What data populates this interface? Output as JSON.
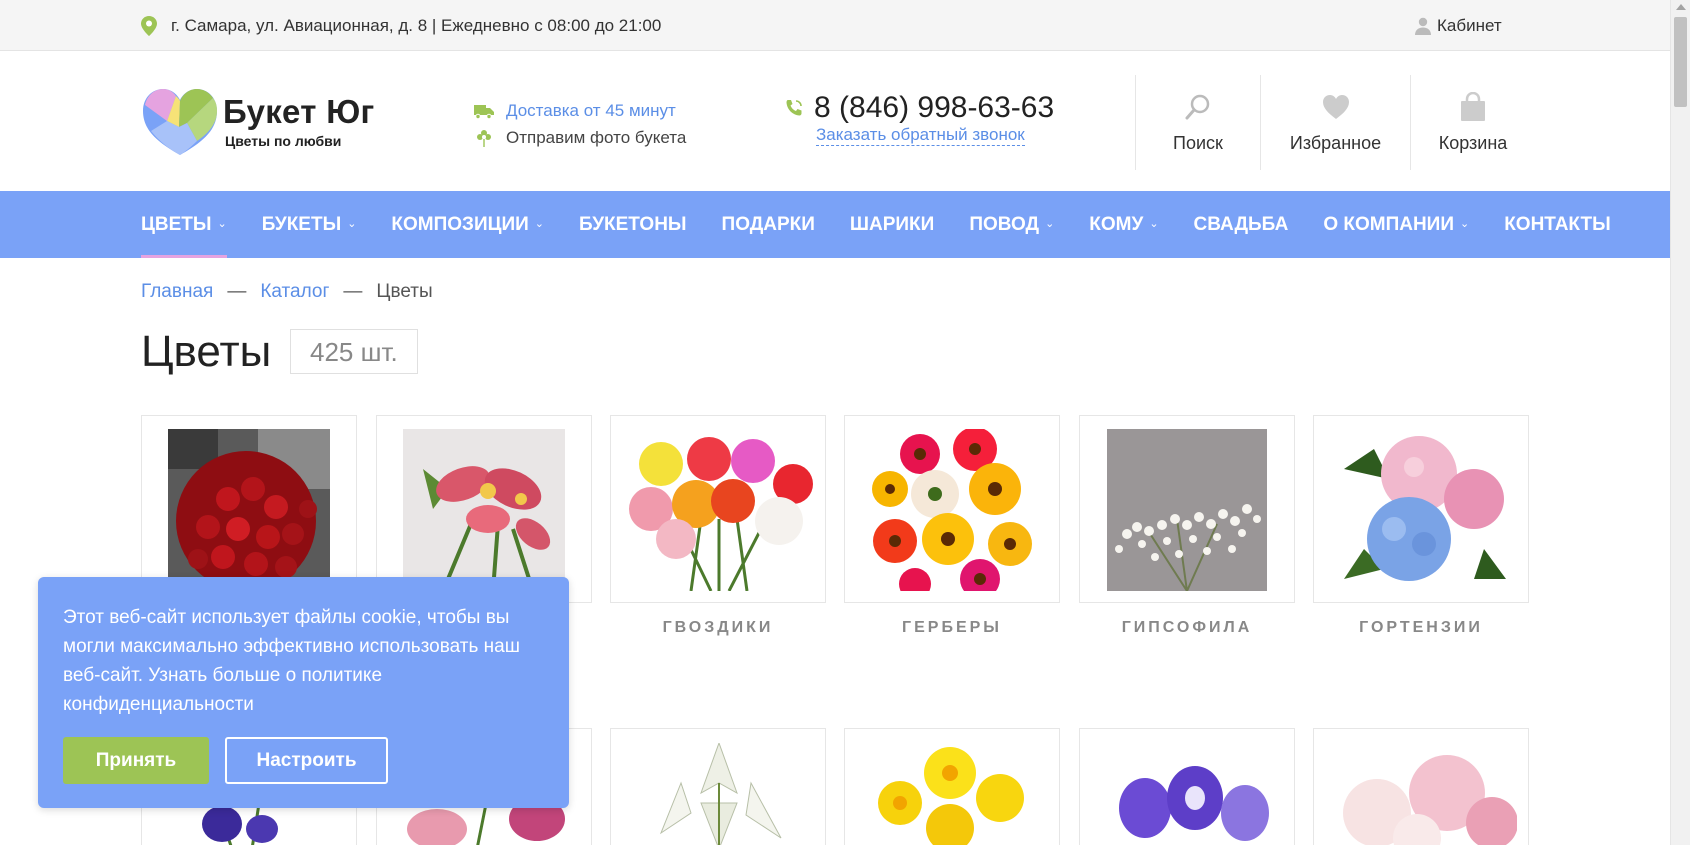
{
  "topbar": {
    "address": "г. Самара, ул. Авиационная, д. 8 | Ежедневно с 08:00 до 21:00",
    "cabinet": "Кабинет"
  },
  "logo": {
    "title": "Букет Юг",
    "subtitle": "Цветы по любви"
  },
  "delivery": {
    "line1": "Доставка от 45 минут",
    "line2": "Отправим фото букета"
  },
  "phone": {
    "number": "8 (846) 998-63-63",
    "callback": "Заказать обратный звонок"
  },
  "header_buttons": {
    "search": "Поиск",
    "favorites": "Избранное",
    "cart": "Корзина"
  },
  "nav": {
    "items": [
      {
        "label": "ЦВЕТЫ",
        "dropdown": true
      },
      {
        "label": "БУКЕТЫ",
        "dropdown": true
      },
      {
        "label": "КОМПОЗИЦИИ",
        "dropdown": true
      },
      {
        "label": "БУКЕТОНЫ",
        "dropdown": false
      },
      {
        "label": "ПОДАРКИ",
        "dropdown": false
      },
      {
        "label": "ШАРИКИ",
        "dropdown": false
      },
      {
        "label": "ПОВОД",
        "dropdown": true
      },
      {
        "label": "КОМУ",
        "dropdown": true
      },
      {
        "label": "СВАДЬБА",
        "dropdown": false
      },
      {
        "label": "О КОМПАНИИ",
        "dropdown": true
      },
      {
        "label": "КОНТАКТЫ",
        "dropdown": false
      }
    ],
    "chevron": "⌄"
  },
  "breadcrumb": {
    "home": "Главная",
    "sep": "—",
    "catalog": "Каталог",
    "current": "Цветы"
  },
  "page": {
    "title": "Цветы",
    "count": "425 шт."
  },
  "categories": {
    "row1_labels": [
      "ГВОЗДИКИ",
      "ГЕРБЕРЫ",
      "ГИПСОФИЛА",
      "ГОРТЕНЗИИ"
    ]
  },
  "cookie": {
    "text": "Этот веб-сайт использует файлы cookie, чтобы вы могли максимально эффективно использовать наш веб-сайт. Узнать больше о политике конфиденциальности",
    "accept": "Принять",
    "settings": "Настроить"
  },
  "colors": {
    "accent": "#7aa2f7",
    "link": "#5b8ee6",
    "accept": "#9dc455"
  }
}
